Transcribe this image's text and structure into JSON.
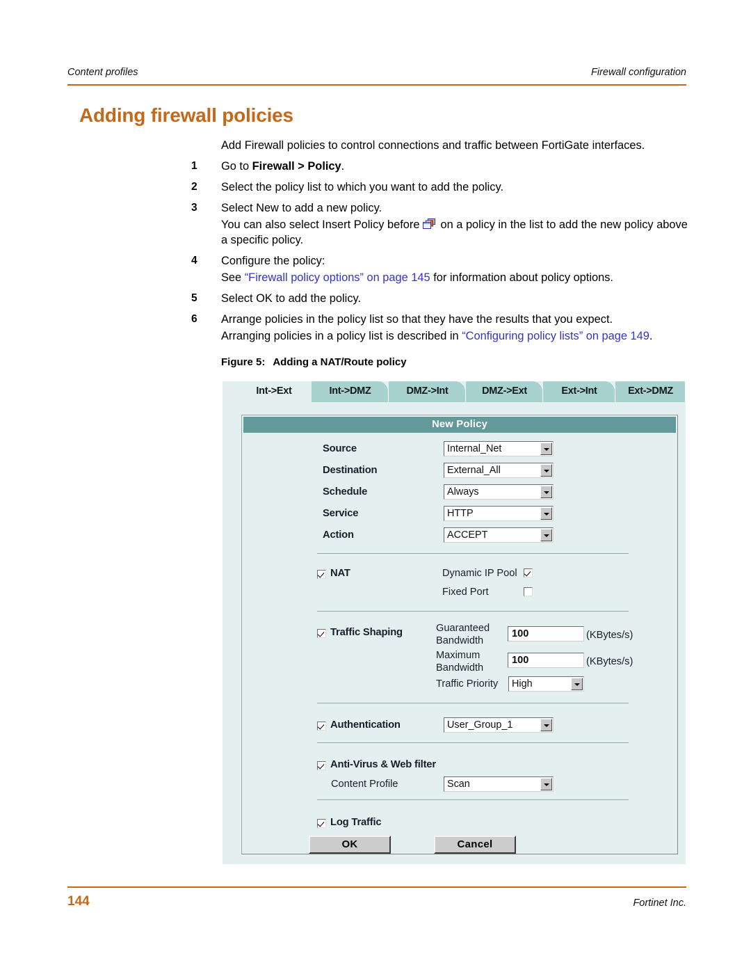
{
  "header": {
    "left": "Content profiles",
    "right": "Firewall configuration"
  },
  "title": "Adding firewall policies",
  "intro": "Add Firewall policies to control connections and traffic between FortiGate interfaces.",
  "steps": [
    {
      "num": "1",
      "text_prefix": "Go to ",
      "text_bold": "Firewall > Policy",
      "text_suffix": "."
    },
    {
      "num": "2",
      "text": "Select the policy list to which you want to add the policy."
    },
    {
      "num": "3",
      "text": "Select New to add a new policy.",
      "sub_a": "You can also select Insert Policy before",
      "sub_icon": "insert-policy-icon",
      "sub_b": "on a policy in the list to add the new policy above a specific policy."
    },
    {
      "num": "4",
      "text": "Configure the policy:",
      "sub_prefix": "See ",
      "sub_link": "“Firewall policy options” on page 145",
      "sub_suffix": " for information about policy options."
    },
    {
      "num": "5",
      "text": "Select OK to add the policy."
    },
    {
      "num": "6",
      "text": "Arrange policies in the policy list so that they have the results that you expect.",
      "sub_prefix": "Arranging policies in a policy list is described in ",
      "sub_link": "“Configuring policy lists” on page 149",
      "sub_suffix": "."
    }
  ],
  "figure": {
    "caption_number": "Figure 5:",
    "caption_text": "Adding a NAT/Route policy",
    "tabs": [
      {
        "label": "Int->Ext",
        "active": true
      },
      {
        "label": "Int->DMZ",
        "active": false
      },
      {
        "label": "DMZ->Int",
        "active": false
      },
      {
        "label": "DMZ->Ext",
        "active": false
      },
      {
        "label": "Ext->Int",
        "active": false
      },
      {
        "label": "Ext->DMZ",
        "active": false
      }
    ],
    "panel_title": "New Policy",
    "fields": [
      {
        "label": "Source",
        "value": "Internal_Net"
      },
      {
        "label": "Destination",
        "value": "External_All"
      },
      {
        "label": "Schedule",
        "value": "Always"
      },
      {
        "label": "Service",
        "value": "HTTP"
      },
      {
        "label": "Action",
        "value": "ACCEPT"
      }
    ],
    "nat": {
      "label": "NAT",
      "checked": true,
      "dynamic_ip_pool_label": "Dynamic IP Pool",
      "dynamic_ip_pool_checked": true,
      "fixed_port_label": "Fixed Port",
      "fixed_port_checked": false
    },
    "traffic_shaping": {
      "label": "Traffic Shaping",
      "checked": true,
      "guaranteed_label_1": "Guaranteed",
      "guaranteed_label_2": "Bandwidth",
      "guaranteed_value": "100",
      "guaranteed_unit": "(KBytes/s)",
      "maximum_label_1": "Maximum",
      "maximum_label_2": "Bandwidth",
      "maximum_value": "100",
      "maximum_unit": "(KBytes/s)",
      "priority_label": "Traffic Priority",
      "priority_value": "High"
    },
    "authentication": {
      "label": "Authentication",
      "checked": true,
      "value": "User_Group_1"
    },
    "antivirus": {
      "label": "Anti-Virus & Web filter",
      "checked": true,
      "content_profile_label": "Content Profile",
      "content_profile_value": "Scan"
    },
    "log_traffic": {
      "label": "Log Traffic",
      "checked": true
    },
    "buttons": {
      "ok": "OK",
      "cancel": "Cancel"
    }
  },
  "footer": {
    "page_number": "144",
    "company": "Fortinet Inc."
  },
  "colors": {
    "accent": "#c2691a",
    "link": "#3333cc",
    "panel_header": "#63999a",
    "tab_inactive": "#a8d2d0",
    "figure_bg": "#e3f0ef"
  }
}
